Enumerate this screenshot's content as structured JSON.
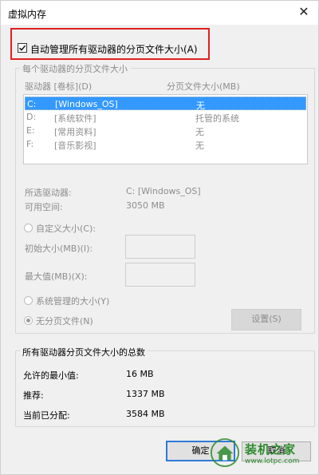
{
  "window": {
    "title": "虚拟内存",
    "close_glyph": "✕"
  },
  "auto_manage": {
    "label": "自动管理所有驱动器的分页文件大小(A)",
    "checked": true
  },
  "drives_group": {
    "legend": "每个驱动器的分页文件大小",
    "col_drive": "驱动器 [卷标](D)",
    "col_size": "分页文件大小(MB)",
    "rows": [
      {
        "drive": "C:",
        "label": "[Windows_OS]",
        "size": "无",
        "selected": true
      },
      {
        "drive": "D:",
        "label": "[系统软件]",
        "size": "托管的系统",
        "selected": false
      },
      {
        "drive": "E:",
        "label": "[常用资料]",
        "size": "无",
        "selected": false
      },
      {
        "drive": "F:",
        "label": "[音乐影视]",
        "size": "无",
        "selected": false
      }
    ],
    "selected_drive_label": "所选驱动器:",
    "selected_drive_value": "C:  [Windows_OS]",
    "free_space_label": "可用空间:",
    "free_space_value": "3050 MB",
    "custom_size_label": "自定义大小(C):",
    "initial_size_label": "初始大小(MB)(I):",
    "initial_size_value": "",
    "max_size_label": "最大值(MB)(X):",
    "max_size_value": "",
    "system_managed_label": "系统管理的大小(Y)",
    "no_paging_label": "无分页文件(N)",
    "set_button": "设置(S)"
  },
  "totals_group": {
    "legend": "所有驱动器分页文件大小的总数",
    "min_label": "允许的最小值:",
    "min_value": "16 MB",
    "recommended_label": "推荐:",
    "recommended_value": "1337 MB",
    "current_label": "当前已分配:",
    "current_value": "3584 MB"
  },
  "buttons": {
    "ok": "确定",
    "cancel": "取消"
  },
  "watermark": {
    "title": "装机之家",
    "url": "www.lotpc.com"
  },
  "colors": {
    "selection": "#3399ff",
    "highlight_box": "#e02020",
    "default_button_border": "#2f7ad6",
    "watermark": "#2e8b2e"
  }
}
